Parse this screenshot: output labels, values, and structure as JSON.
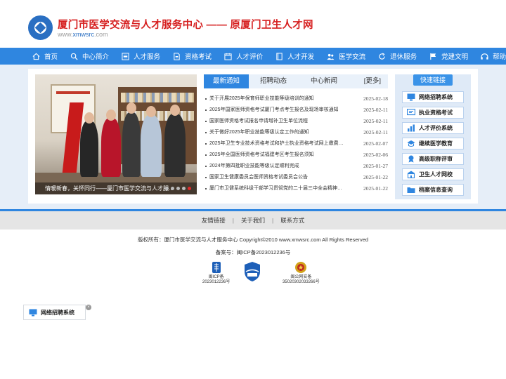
{
  "header": {
    "title": "厦门市医学交流与人才服务中心   —— 原厦门卫生人才网",
    "url_prefix": "www.",
    "url_brand": "xmwsrc",
    "url_suffix": ".com"
  },
  "nav": {
    "items": [
      {
        "label": "首页",
        "icon": "home-icon"
      },
      {
        "label": "中心简介",
        "icon": "search-icon"
      },
      {
        "label": "人才服务",
        "icon": "list-icon"
      },
      {
        "label": "资格考试",
        "icon": "document-icon"
      },
      {
        "label": "人才评价",
        "icon": "calendar-icon"
      },
      {
        "label": "人才开发",
        "icon": "book-icon"
      },
      {
        "label": "医学交流",
        "icon": "people-icon"
      },
      {
        "label": "退休服务",
        "icon": "refresh-icon"
      },
      {
        "label": "党建文明",
        "icon": "flag-icon"
      },
      {
        "label": "帮助",
        "icon": "help-icon"
      }
    ]
  },
  "slider": {
    "caption": "情暖新春，关怀同行——厦门市医学交流与人才服...",
    "dot_count": 5,
    "active_dot": 5
  },
  "news": {
    "tabs": [
      "最新通知",
      "招聘动态",
      "中心新闻"
    ],
    "more": "[更多]",
    "items": [
      {
        "title": "关于开展2025年保育师职业技能等级培训的通知",
        "date": "2025-02-18"
      },
      {
        "title": "2025年国家医师资格考试厦门考点考生报名及现场审核通知",
        "date": "2025-02-11"
      },
      {
        "title": "国家医师资格考试报名申请增补卫生单位流程",
        "date": "2025-02-11"
      },
      {
        "title": "关于做好2025年职业技能等级认定工作的通知",
        "date": "2025-02-11"
      },
      {
        "title": "2025年卫生专业技术资格考试和护士执业资格考试网上缴费…",
        "date": "2025-02-07"
      },
      {
        "title": "2025年全国医师资格考试福建考区考生报名须知",
        "date": "2025-02-06"
      },
      {
        "title": "2024年第四批职业技能等级认定顺利完成",
        "date": "2025-01-27"
      },
      {
        "title": "国家卫生健康委员会医师资格考试委员会公告",
        "date": "2025-01-22"
      },
      {
        "title": "厦门市卫健系统科级干部学习贯彻党的二十届三中全会精神…",
        "date": "2025-01-22"
      }
    ]
  },
  "quick": {
    "title": "快速链接",
    "items": [
      {
        "label": "网络招聘系统",
        "icon": "monitor-icon"
      },
      {
        "label": "执业资格考试",
        "icon": "certificate-icon"
      },
      {
        "label": "人才评价系统",
        "icon": "chart-icon"
      },
      {
        "label": "继续医学教育",
        "icon": "education-icon"
      },
      {
        "label": "高级职称评审",
        "icon": "award-icon"
      },
      {
        "label": "卫生人才网校",
        "icon": "school-icon"
      },
      {
        "label": "档案信息查询",
        "icon": "folder-icon"
      }
    ]
  },
  "footer": {
    "links": [
      "友情链接",
      "关于我们",
      "联系方式"
    ],
    "copyright": "版权所有：厦门市医学交流与人才服务中心  Copyright©2010  www.xmwsrc.com  All Rights Reserved",
    "icp": "备案号：闽ICP备2023012236号",
    "badges": [
      {
        "line1": "闽ICP备",
        "line2": "2023012236号"
      },
      {
        "line1": "",
        "line2": ""
      },
      {
        "line1": "闽公网安备",
        "line2": "35020302033266号"
      }
    ]
  },
  "floating": {
    "label": "网络招聘系统",
    "close": "×"
  },
  "colors": {
    "brand_red": "#d61f1f",
    "nav_blue": "#2f86e0",
    "active_dot": "#e02a2a"
  }
}
